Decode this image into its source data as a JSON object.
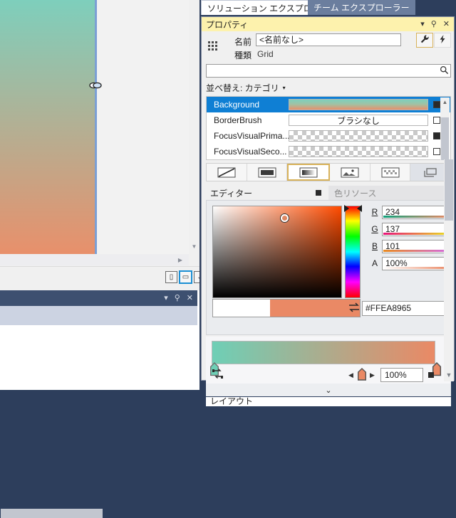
{
  "tabs": [
    {
      "label": "ソリューション エクスプローラー",
      "selected": true
    },
    {
      "label": "チーム エクスプローラー",
      "selected": false
    }
  ],
  "properties_window": {
    "title": "プロパティ",
    "title_icons": [
      {
        "name": "chevron-down-icon",
        "glyph": "▾"
      },
      {
        "name": "pin-icon",
        "glyph": "⚲"
      },
      {
        "name": "close-icon",
        "glyph": "✕"
      }
    ],
    "identity": {
      "name_label": "名前",
      "name_value": "<名前なし>",
      "name_placeholder": "<名前なし>",
      "type_label": "種類",
      "type_value": "Grid",
      "wrench_icon": "wrench-icon",
      "events_icon": "lightning-icon"
    },
    "search": {
      "value": "",
      "placeholder": "",
      "icon": "search-icon"
    },
    "sort": {
      "label": "並べ替え: カテゴリ",
      "caret": "▾"
    },
    "rows": [
      {
        "name": "Background",
        "value_kind": "gradient",
        "value_text": "",
        "marker": "filled",
        "selected": true
      },
      {
        "name": "BorderBrush",
        "value_kind": "text",
        "value_text": "ブラシなし",
        "marker": "empty",
        "selected": false
      },
      {
        "name": "FocusVisualPrima...",
        "value_kind": "checker",
        "value_text": "",
        "marker": "filled",
        "selected": false
      },
      {
        "name": "FocusVisualSeco...",
        "value_kind": "checker",
        "value_text": "",
        "marker": "empty",
        "selected": false
      }
    ],
    "brush_types": [
      {
        "name": "no-brush-icon",
        "selected": false
      },
      {
        "name": "solid-brush-icon",
        "selected": false
      },
      {
        "name": "gradient-brush-icon",
        "selected": true
      },
      {
        "name": "image-brush-icon",
        "selected": false
      },
      {
        "name": "tile-brush-icon",
        "selected": false
      },
      {
        "name": "brush-resource-icon",
        "selected": false
      }
    ],
    "editor_tabs": {
      "editor_label": "エディター",
      "resource_label": "色リソース"
    },
    "color": {
      "r_label": "R",
      "r_value": "234",
      "g_label": "G",
      "g_value": "137",
      "b_label": "B",
      "b_value": "101",
      "a_label": "A",
      "a_value": "100%",
      "hex_value": "#FFEA8965",
      "hex_swap_icon": "swap-icon",
      "eyedropper_icon": "eyedropper-icon",
      "current_hex": "#EA8965",
      "previous_hex": "#FFFFFF"
    },
    "gradient": {
      "start_color": "#6ECFB6",
      "end_color": "#EA8965",
      "reverse_icon": "reverse-gradient-icon",
      "stepper_left": "◀",
      "stepper_right": "▶",
      "offset_value": "100%",
      "offset_marker": "filled"
    },
    "expander_glyph": "⌄",
    "tail_label": "レイアウト"
  },
  "designer": {
    "artboard": {
      "top_color": "#7ECFBC",
      "bottom_color": "#E8906B"
    },
    "cursor_icon": "link-cursor-icon",
    "hscrollbar": {
      "name": "horizontal-scrollbar",
      "right_arrow": "▶"
    },
    "vscrollbar": {
      "name": "vertical-scrollbar",
      "down_arrow": "▼"
    },
    "split_buttons": [
      {
        "name": "split-vertical-button",
        "glyph": "▯",
        "selected": false
      },
      {
        "name": "split-horizontal-button",
        "glyph": "▭",
        "selected": true
      },
      {
        "name": "collapse-pane-button",
        "glyph": "⌄",
        "selected": false
      }
    ]
  },
  "bottom_panel": {
    "icons": [
      {
        "name": "chevron-down-icon",
        "glyph": "▾"
      },
      {
        "name": "pin-icon",
        "glyph": "⚲"
      },
      {
        "name": "close-icon",
        "glyph": "✕"
      }
    ]
  },
  "colors": {
    "accent_blue": "#0F7FD4",
    "title_yellow": "#FDF2AD",
    "window_chrome": "#2D3E5C",
    "selected_tab_blue": "#6B7E9E"
  }
}
